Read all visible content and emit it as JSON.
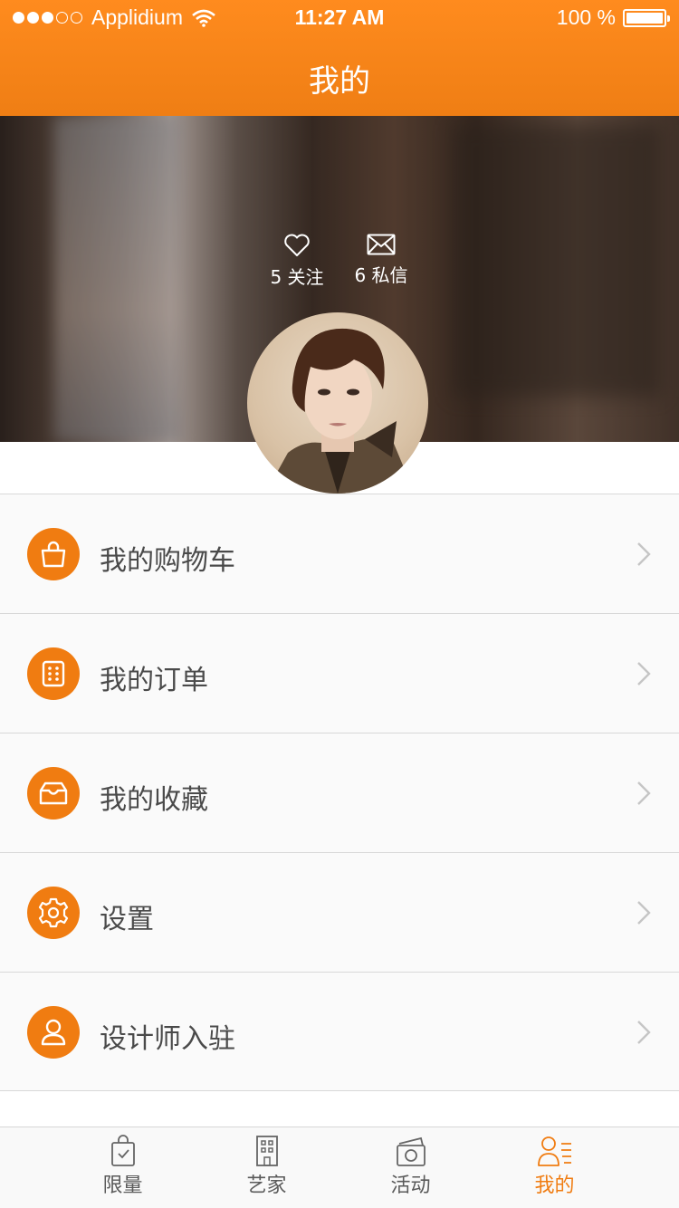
{
  "status_bar": {
    "carrier": "Applidium",
    "time": "11:27 AM",
    "battery": "100 %"
  },
  "header": {
    "title": "我的"
  },
  "profile": {
    "follow_count": "5",
    "follow_label": "关注",
    "message_count": "6",
    "message_label": "私信"
  },
  "menu": [
    {
      "label": "我的购物车",
      "icon": "shopping-bag-icon"
    },
    {
      "label": "我的订单",
      "icon": "order-icon"
    },
    {
      "label": "我的收藏",
      "icon": "favorites-tray-icon"
    },
    {
      "label": "设置",
      "icon": "gear-icon"
    },
    {
      "label": "设计师入驻",
      "icon": "user-icon"
    }
  ],
  "tabbar": [
    {
      "label": "限量",
      "icon": "bag-check-icon",
      "active": false
    },
    {
      "label": "艺家",
      "icon": "building-icon",
      "active": false
    },
    {
      "label": "活动",
      "icon": "camera-icon",
      "active": false
    },
    {
      "label": "我的",
      "icon": "profile-list-icon",
      "active": true
    }
  ],
  "colors": {
    "accent": "#f07c11",
    "header": "#ff8b1e"
  }
}
